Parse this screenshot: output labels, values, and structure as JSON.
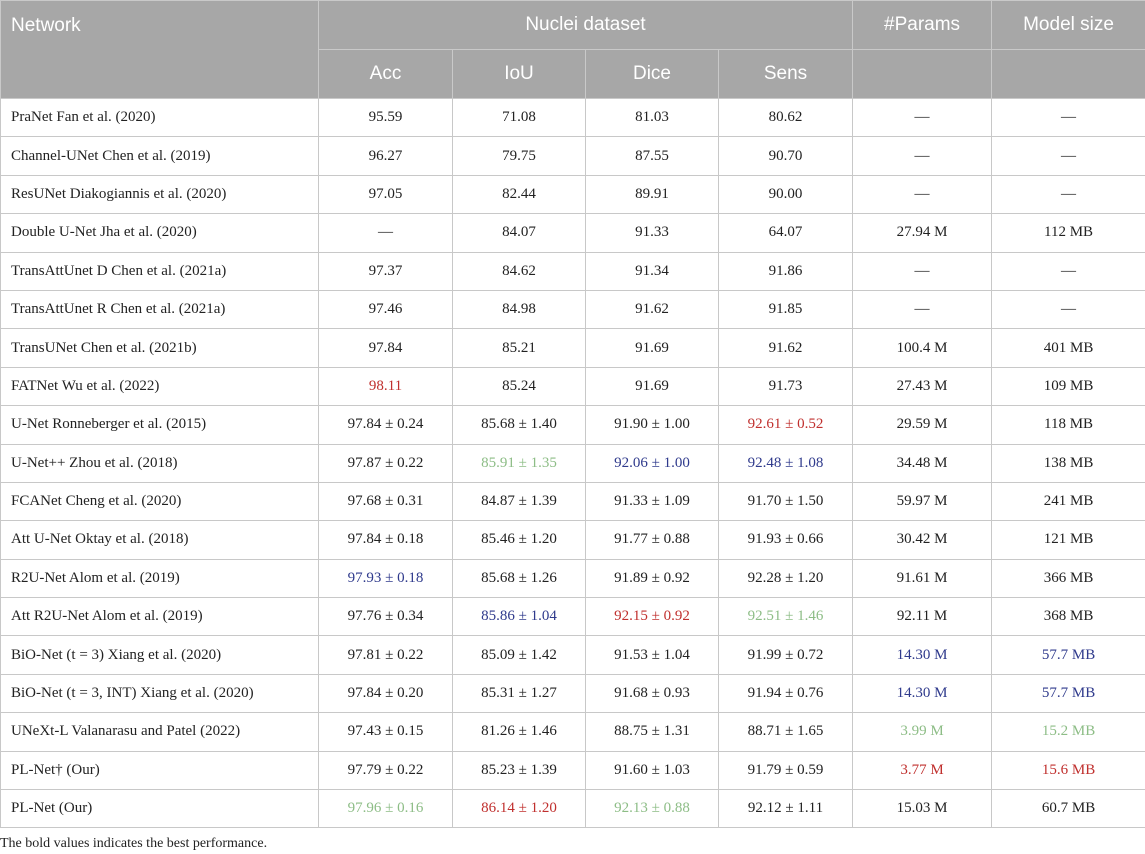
{
  "header": {
    "network": "Network",
    "dataset": "Nuclei dataset",
    "params": "#Params",
    "model_size": "Model size",
    "metrics": [
      "Acc",
      "IoU",
      "Dice",
      "Sens"
    ]
  },
  "colors": {
    "best": "#c0302e",
    "second": "#2f3a8c",
    "third": "#8dbd86",
    "header_bg": "#a7a7a7"
  },
  "rows": [
    {
      "cells": [
        "PraNet Fan et al. (2020)",
        "95.59",
        "71.08",
        "81.03",
        "80.62",
        "—",
        "—"
      ],
      "hl": [
        "",
        "",
        "",
        "",
        "",
        "",
        ""
      ]
    },
    {
      "cells": [
        "Channel-UNet Chen et al. (2019)",
        "96.27",
        "79.75",
        "87.55",
        "90.70",
        "—",
        "—"
      ],
      "hl": [
        "",
        "",
        "",
        "",
        "",
        "",
        ""
      ]
    },
    {
      "cells": [
        "ResUNet Diakogiannis et al. (2020)",
        "97.05",
        "82.44",
        "89.91",
        "90.00",
        "—",
        "—"
      ],
      "hl": [
        "",
        "",
        "",
        "",
        "",
        "",
        ""
      ]
    },
    {
      "cells": [
        "Double U-Net Jha et al. (2020)",
        "—",
        "84.07",
        "91.33",
        "64.07",
        "27.94 M",
        "112 MB"
      ],
      "hl": [
        "",
        "",
        "",
        "",
        "",
        "",
        ""
      ]
    },
    {
      "cells": [
        "TransAttUnet D Chen et al. (2021a)",
        "97.37",
        "84.62",
        "91.34",
        "91.86",
        "—",
        "—"
      ],
      "hl": [
        "",
        "",
        "",
        "",
        "",
        "",
        ""
      ]
    },
    {
      "cells": [
        "TransAttUnet R Chen et al. (2021a)",
        "97.46",
        "84.98",
        "91.62",
        "91.85",
        "—",
        "—"
      ],
      "hl": [
        "",
        "",
        "",
        "",
        "",
        "",
        ""
      ]
    },
    {
      "cells": [
        "TransUNet Chen et al. (2021b)",
        "97.84",
        "85.21",
        "91.69",
        "91.62",
        "100.4 M",
        "401 MB"
      ],
      "hl": [
        "",
        "",
        "",
        "",
        "",
        "",
        ""
      ]
    },
    {
      "cells": [
        "FATNet Wu et al. (2022)",
        "98.11",
        "85.24",
        "91.69",
        "91.73",
        "27.43 M",
        "109 MB"
      ],
      "hl": [
        "",
        "red",
        "",
        "",
        "",
        "",
        ""
      ]
    },
    {
      "cells": [
        "U-Net Ronneberger et al. (2015)",
        "97.84 ± 0.24",
        "85.68 ± 1.40",
        "91.90 ± 1.00",
        "92.61 ± 0.52",
        "29.59 M",
        "118 MB"
      ],
      "hl": [
        "",
        "",
        "",
        "",
        "red",
        "",
        ""
      ]
    },
    {
      "cells": [
        "U-Net++ Zhou et al. (2018)",
        "97.87 ± 0.22",
        "85.91 ± 1.35",
        "92.06 ± 1.00",
        "92.48 ± 1.08",
        "34.48 M",
        "138 MB"
      ],
      "hl": [
        "",
        "",
        "green",
        "blue",
        "blue",
        "",
        ""
      ]
    },
    {
      "cells": [
        "FCANet Cheng et al. (2020)",
        "97.68 ± 0.31",
        "84.87 ± 1.39",
        "91.33 ± 1.09",
        "91.70 ± 1.50",
        "59.97 M",
        "241 MB"
      ],
      "hl": [
        "",
        "",
        "",
        "",
        "",
        "",
        ""
      ]
    },
    {
      "cells": [
        "Att U-Net Oktay et al. (2018)",
        "97.84 ± 0.18",
        "85.46 ± 1.20",
        "91.77 ± 0.88",
        "91.93 ± 0.66",
        "30.42 M",
        "121 MB"
      ],
      "hl": [
        "",
        "",
        "",
        "",
        "",
        "",
        ""
      ]
    },
    {
      "cells": [
        "R2U-Net Alom et al. (2019)",
        "97.93 ± 0.18",
        "85.68 ± 1.26",
        "91.89 ± 0.92",
        "92.28 ± 1.20",
        "91.61 M",
        "366 MB"
      ],
      "hl": [
        "",
        "blue",
        "",
        "",
        "",
        "",
        ""
      ]
    },
    {
      "cells": [
        "Att R2U-Net Alom et al. (2019)",
        "97.76 ± 0.34",
        "85.86 ± 1.04",
        "92.15 ± 0.92",
        "92.51 ± 1.46",
        "92.11 M",
        "368 MB"
      ],
      "hl": [
        "",
        "",
        "blue",
        "red",
        "green",
        "",
        ""
      ]
    },
    {
      "cells": [
        "BiO-Net (t = 3) Xiang et al. (2020)",
        "97.81 ± 0.22",
        "85.09 ± 1.42",
        "91.53 ± 1.04",
        "91.99 ± 0.72",
        "14.30 M",
        "57.7 MB"
      ],
      "hl": [
        "",
        "",
        "",
        "",
        "",
        "blue",
        "blue"
      ]
    },
    {
      "cells": [
        "BiO-Net (t = 3, INT) Xiang et al. (2020)",
        "97.84 ± 0.20",
        "85.31 ± 1.27",
        "91.68 ± 0.93",
        "91.94 ± 0.76",
        "14.30 M",
        "57.7 MB"
      ],
      "hl": [
        "",
        "",
        "",
        "",
        "",
        "blue",
        "blue"
      ]
    },
    {
      "cells": [
        "UNeXt-L Valanarasu and Patel (2022)",
        "97.43 ± 0.15",
        "81.26 ± 1.46",
        "88.75 ± 1.31",
        "88.71 ± 1.65",
        "3.99 M",
        "15.2 MB"
      ],
      "hl": [
        "",
        "",
        "",
        "",
        "",
        "green",
        "green"
      ]
    },
    {
      "cells": [
        "PL-Net† (Our)",
        "97.79 ± 0.22",
        "85.23 ± 1.39",
        "91.60 ± 1.03",
        "91.79 ± 0.59",
        "3.77 M",
        "15.6 MB"
      ],
      "hl": [
        "",
        "",
        "",
        "",
        "",
        "red",
        "red"
      ]
    },
    {
      "cells": [
        "PL-Net (Our)",
        "97.96 ± 0.16",
        "86.14 ± 1.20",
        "92.13 ± 0.88",
        "92.12 ± 1.11",
        "15.03 M",
        "60.7 MB"
      ],
      "hl": [
        "",
        "green",
        "red",
        "green",
        "",
        "",
        ""
      ]
    }
  ],
  "footnote": "The bold values indicates the best performance."
}
